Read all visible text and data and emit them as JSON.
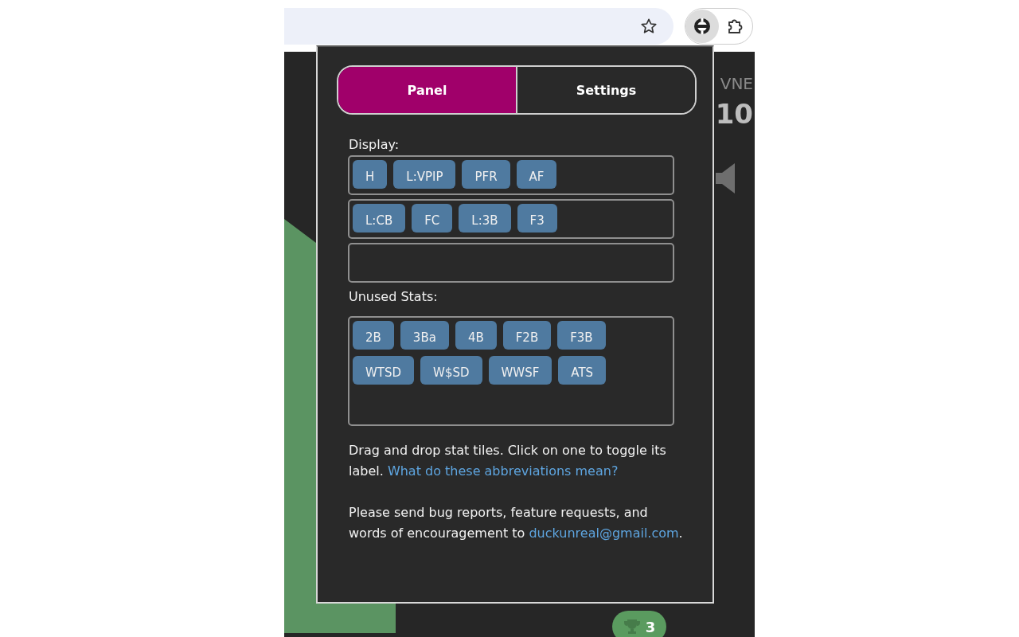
{
  "tabs": [
    {
      "label": "Panel",
      "selected": true
    },
    {
      "label": "Settings",
      "selected": false
    }
  ],
  "display": {
    "label": "Display:",
    "rows": [
      [
        "H",
        "L:VPIP",
        "PFR",
        "AF"
      ],
      [
        "L:CB",
        "FC",
        "L:3B",
        "F3"
      ],
      []
    ]
  },
  "unused": {
    "label": "Unused Stats:",
    "tiles": [
      "2B",
      "3Ba",
      "4B",
      "F2B",
      "F3B",
      "WTSD",
      "W$SD",
      "WWSF",
      "ATS"
    ]
  },
  "help": {
    "text": "Drag and drop stat tiles. Click on one to toggle its label.",
    "link": "What do these abbreviations mean?"
  },
  "contact": {
    "text": "Please send bug reports, feature requests, and words of encouragement to",
    "email": "duckunreal@gmail.com",
    "after": "."
  },
  "background": {
    "label": "VNE",
    "value": "10",
    "badge": "3"
  }
}
